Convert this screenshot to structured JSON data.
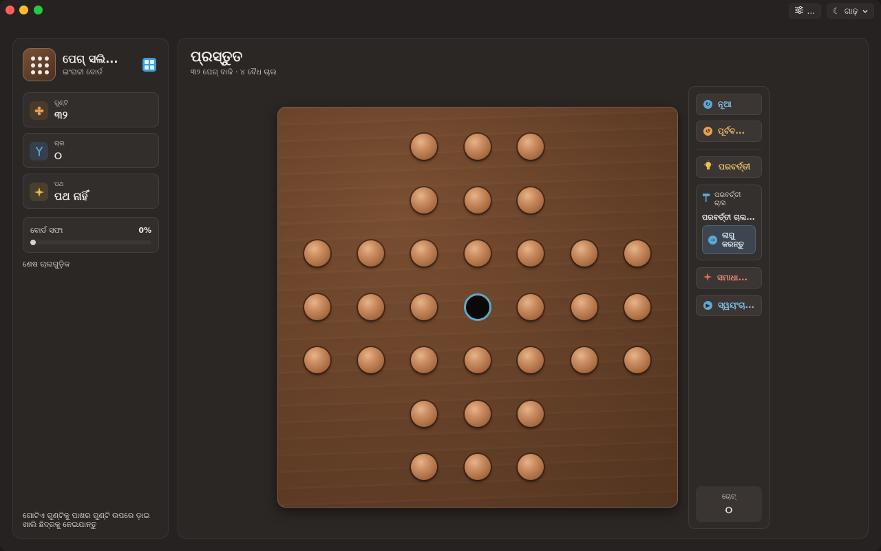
{
  "window": {
    "toolbar": {
      "settings_label": "...",
      "theme_label": "ଗାଢ଼"
    }
  },
  "sidebar": {
    "app_title": "ପେଗ୍ ସଲି...",
    "app_subtitle": "ଇଂରାଜୀ ବୋର୍ଡ",
    "stats": [
      {
        "label": "ଗୁଣ୍ଟି",
        "value": "୩୨",
        "icon": "pegs-icon",
        "color": "#e7a24a"
      },
      {
        "label": "ଚାଲ",
        "value": "୦",
        "icon": "branch-icon",
        "color": "#5ba8d6"
      },
      {
        "label": "ପଥ",
        "value": "ପଥ ନାହିଁ",
        "icon": "sparkle-icon",
        "color": "#e7b850"
      }
    ],
    "progress": {
      "label": "ବୋର୍ଡ ସଫା",
      "percent_text": "0%",
      "percent": 0
    },
    "section_title": "ଶେଷ ଚାଲଗୁଡ଼ିକ",
    "hint": "ଗୋଟିଏ ଗୁଣ୍ଟିକୁ ପାଖର ଗୁଣ୍ଟି ଉପରେ ଡ଼ାଇ ଖାଲି ଛିଦ୍ରକୁ ନେଇଯାନ୍ତୁ"
  },
  "main": {
    "title": "ପ୍ରସ୍ତୁତ",
    "subtitle": "୩୨ ପେଗ୍ ବାକି · ୪ ବୈଧ ଚାଲ",
    "board": {
      "layout": [
        "..XXX..",
        "..XXX..",
        "XXXXXXX",
        "XXXOXXX",
        "XXXXXXX",
        "..XXX..",
        "..XXX.."
      ]
    }
  },
  "controls": {
    "new_label": "ନୂଆ",
    "undo_label": "ପୂର୍ବବ...",
    "hint_label": "ପରବର୍ତ୍ତୀ",
    "next_move": {
      "title": "ପରବର୍ତ୍ତୀ ଚାଲ",
      "desc": "ପରବର୍ତ୍ତୀ ଚାଲ...",
      "apply_label": "ଲାଗୁ କରନ୍ତୁ"
    },
    "solve_label": "ସମାଧା...",
    "autoplay_label": "ସ୍ୱୟଂଚା...",
    "moves": {
      "label": "ଚୋଟ୍",
      "value": "୦"
    }
  },
  "colors": {
    "accent_blue": "#5ba8d6",
    "accent_orange": "#e7a24a",
    "accent_red": "#e26b55",
    "peg": "#c88a5e"
  }
}
